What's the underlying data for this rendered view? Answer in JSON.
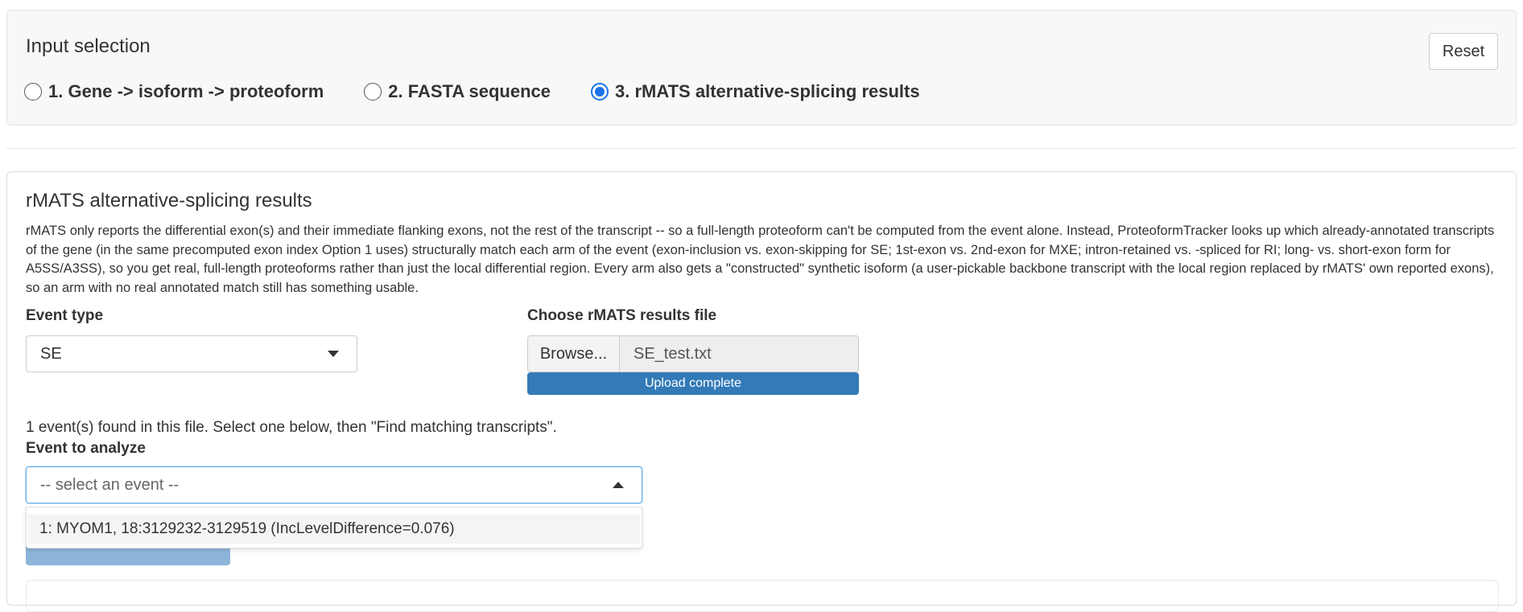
{
  "input_selection": {
    "title": "Input selection",
    "reset_label": "Reset",
    "options": [
      {
        "label": "1. Gene -> isoform -> proteoform",
        "checked": false
      },
      {
        "label": "2. FASTA sequence",
        "checked": false
      },
      {
        "label": "3. rMATS alternative-splicing results",
        "checked": true
      }
    ]
  },
  "rmats": {
    "title": "rMATS alternative-splicing results",
    "description": "rMATS only reports the differential exon(s) and their immediate flanking exons, not the rest of the transcript -- so a full-length proteoform can't be computed from the event alone. Instead, ProteoformTracker looks up which already-annotated transcripts of the gene (in the same precomputed exon index Option 1 uses) structurally match each arm of the event (exon-inclusion vs. exon-skipping for SE; 1st-exon vs. 2nd-exon for MXE; intron-retained vs. -spliced for RI; long- vs. short-exon form for A5SS/A3SS), so you get real, full-length proteoforms rather than just the local differential region. Every arm also gets a \"constructed\" synthetic isoform (a user-pickable backbone transcript with the local region replaced by rMATS' own reported exons), so an arm with no real annotated match still has something usable.",
    "event_type": {
      "label": "Event type",
      "value": "SE"
    },
    "file": {
      "label": "Choose rMATS results file",
      "browse_label": "Browse...",
      "filename": "SE_test.txt",
      "progress_label": "Upload complete",
      "progress_fraction": 1.0
    },
    "found_text": "1 event(s) found in this file. Select one below, then \"Find matching transcripts\".",
    "event_select": {
      "label": "Event to analyze",
      "placeholder": "-- select an event --",
      "options": [
        "1: MYOM1, 18:3129232-3129519 (IncLevelDifference=0.076)"
      ]
    }
  },
  "colors": {
    "accent": "#1a73e8",
    "progress": "#337ab7",
    "panel_bg": "#f8f8f8"
  }
}
